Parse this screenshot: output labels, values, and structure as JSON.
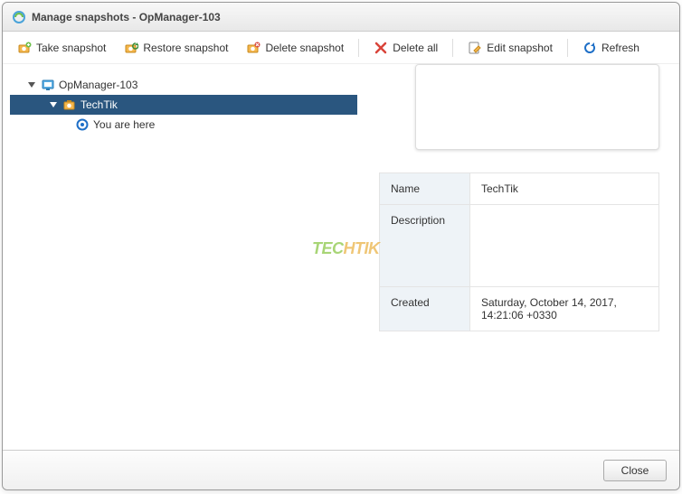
{
  "window": {
    "title": "Manage snapshots - OpManager-103"
  },
  "toolbar": {
    "take": "Take snapshot",
    "restore": "Restore snapshot",
    "delete": "Delete snapshot",
    "delete_all": "Delete all",
    "edit": "Edit snapshot",
    "refresh": "Refresh"
  },
  "tree": {
    "root": "OpManager-103",
    "child": "TechTik",
    "here": "You are here"
  },
  "details": {
    "name_label": "Name",
    "name_value": "TechTik",
    "desc_label": "Description",
    "desc_value": "",
    "created_label": "Created",
    "created_value": "Saturday, October 14, 2017, 14:21:06 +0330"
  },
  "footer": {
    "close": "Close"
  },
  "watermark": {
    "p1": "TEC",
    "p2": "HTIK"
  }
}
